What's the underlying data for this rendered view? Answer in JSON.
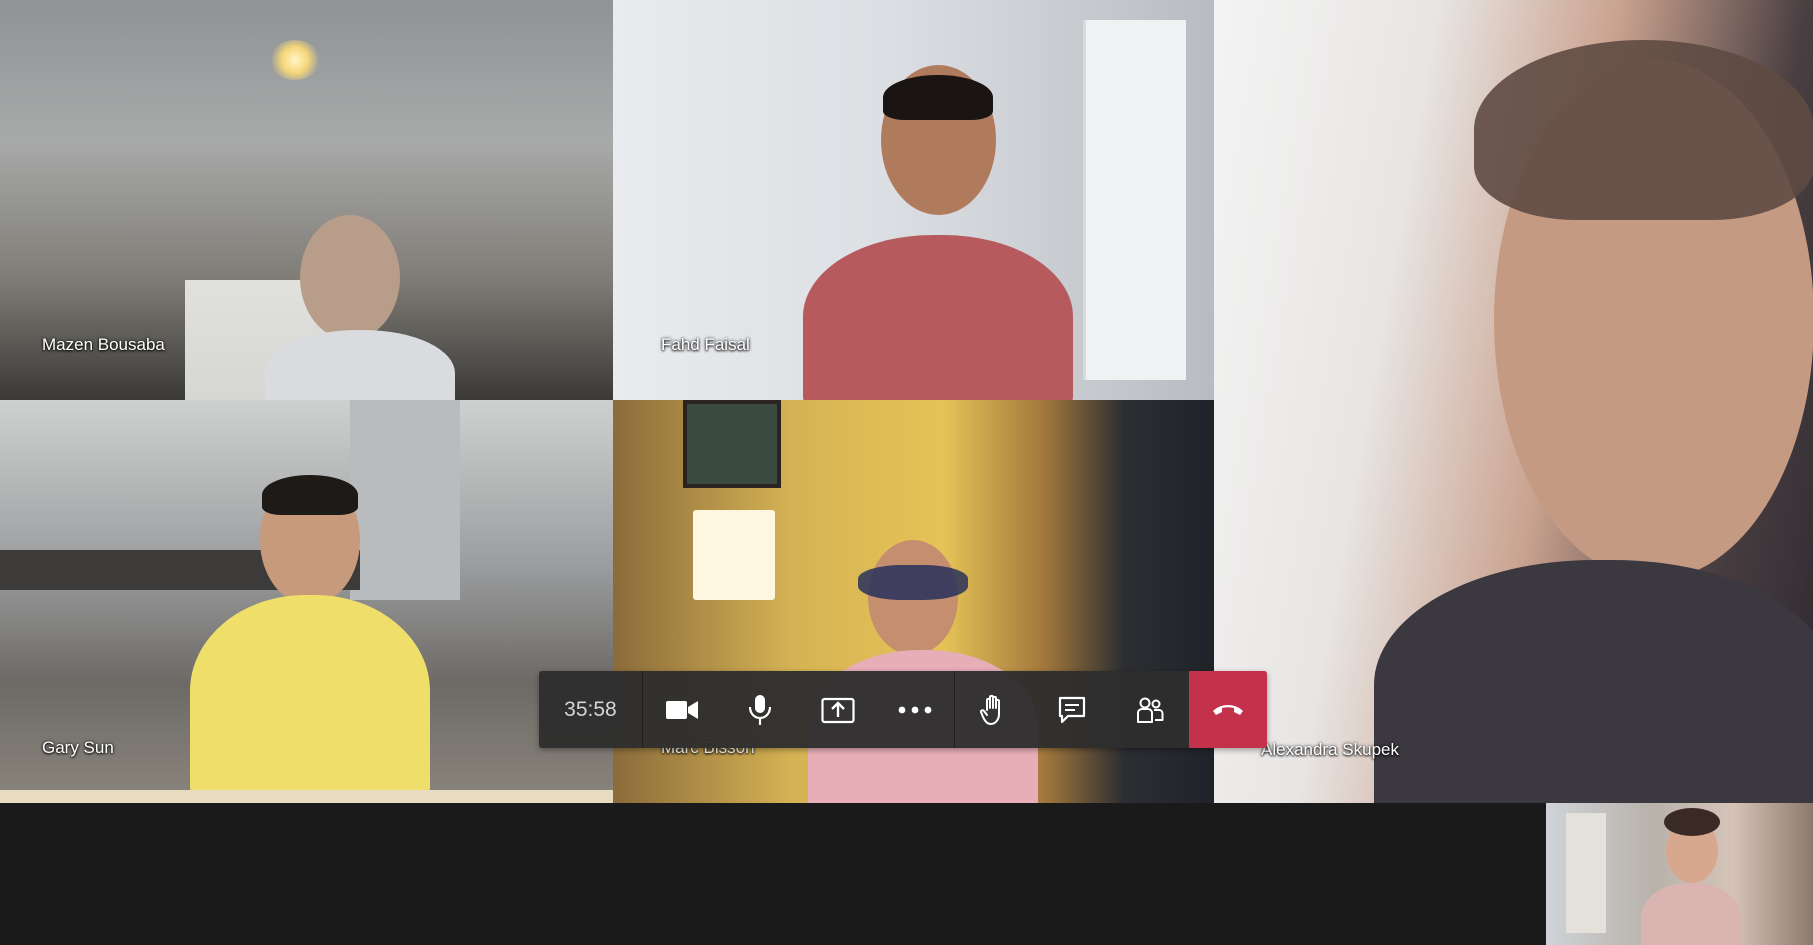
{
  "participants": {
    "mazen": {
      "name": "Mazen Bousaba"
    },
    "fahd": {
      "name": "Fahd Faisal"
    },
    "alexandra": {
      "name": "Alexandra Skupek"
    },
    "gary": {
      "name": "Gary Sun"
    },
    "marc": {
      "name": "Marc Bisson"
    }
  },
  "toolbar": {
    "timer": "35:58",
    "buttons": [
      {
        "id": "camera",
        "icon": "video-camera-icon"
      },
      {
        "id": "mic",
        "icon": "microphone-icon"
      },
      {
        "id": "share",
        "icon": "share-screen-icon"
      },
      {
        "id": "more",
        "icon": "more-options-icon"
      },
      {
        "id": "raise-hand",
        "icon": "raise-hand-icon"
      },
      {
        "id": "chat",
        "icon": "chat-icon"
      },
      {
        "id": "participants",
        "icon": "participants-icon"
      },
      {
        "id": "hangup",
        "icon": "hang-up-icon"
      }
    ]
  },
  "colors": {
    "toolbar_bg": "#2e2e2e",
    "hangup": "#c4314b",
    "icon": "#ffffff",
    "stage_bg": "#1a1a1a"
  }
}
